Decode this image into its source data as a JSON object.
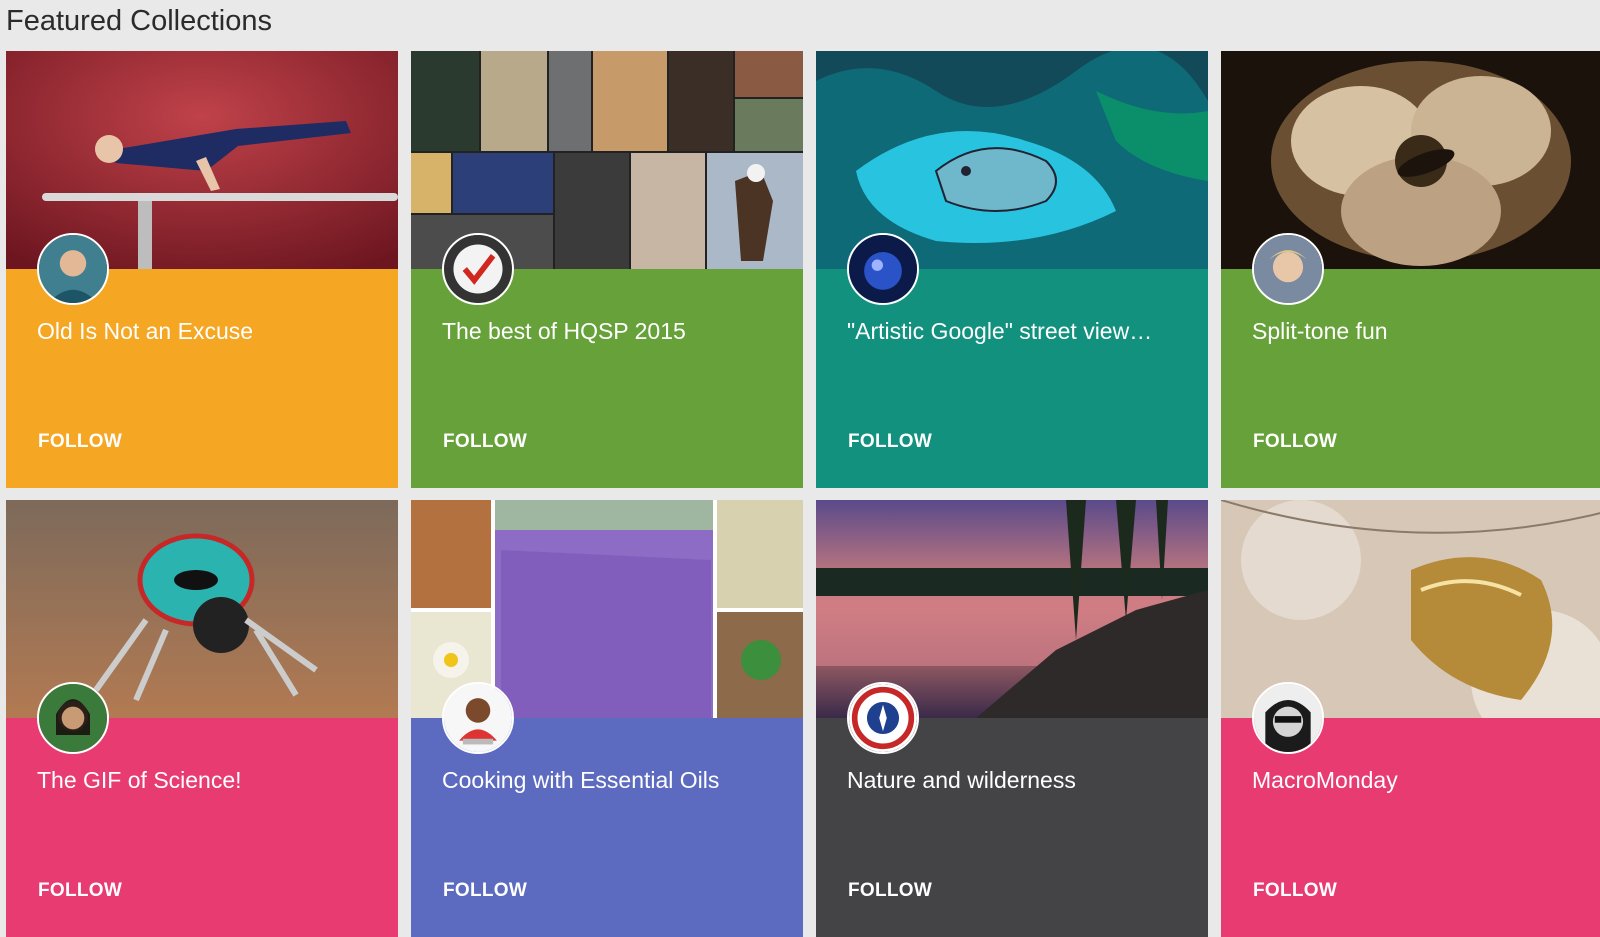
{
  "section": {
    "title": "Featured Collections"
  },
  "cards": [
    {
      "title": "Old Is Not an Excuse",
      "follow_label": "FOLLOW",
      "color": "#f5a623"
    },
    {
      "title": "The best of HQSP 2015",
      "follow_label": "FOLLOW",
      "color": "#66a13a"
    },
    {
      "title": "\"Artistic Google\" street view…",
      "follow_label": "FOLLOW",
      "color": "#11917e"
    },
    {
      "title": "Split-tone fun",
      "follow_label": "FOLLOW",
      "color": "#66a13a"
    },
    {
      "title": "The GIF of Science!",
      "follow_label": "FOLLOW",
      "color": "#e83b72"
    },
    {
      "title": "Cooking with Essential Oils",
      "follow_label": "FOLLOW",
      "color": "#5c6bc0"
    },
    {
      "title": "Nature and wilderness",
      "follow_label": "FOLLOW",
      "color": "#444446"
    },
    {
      "title": "MacroMonday",
      "follow_label": "FOLLOW",
      "color": "#e83b72"
    }
  ]
}
